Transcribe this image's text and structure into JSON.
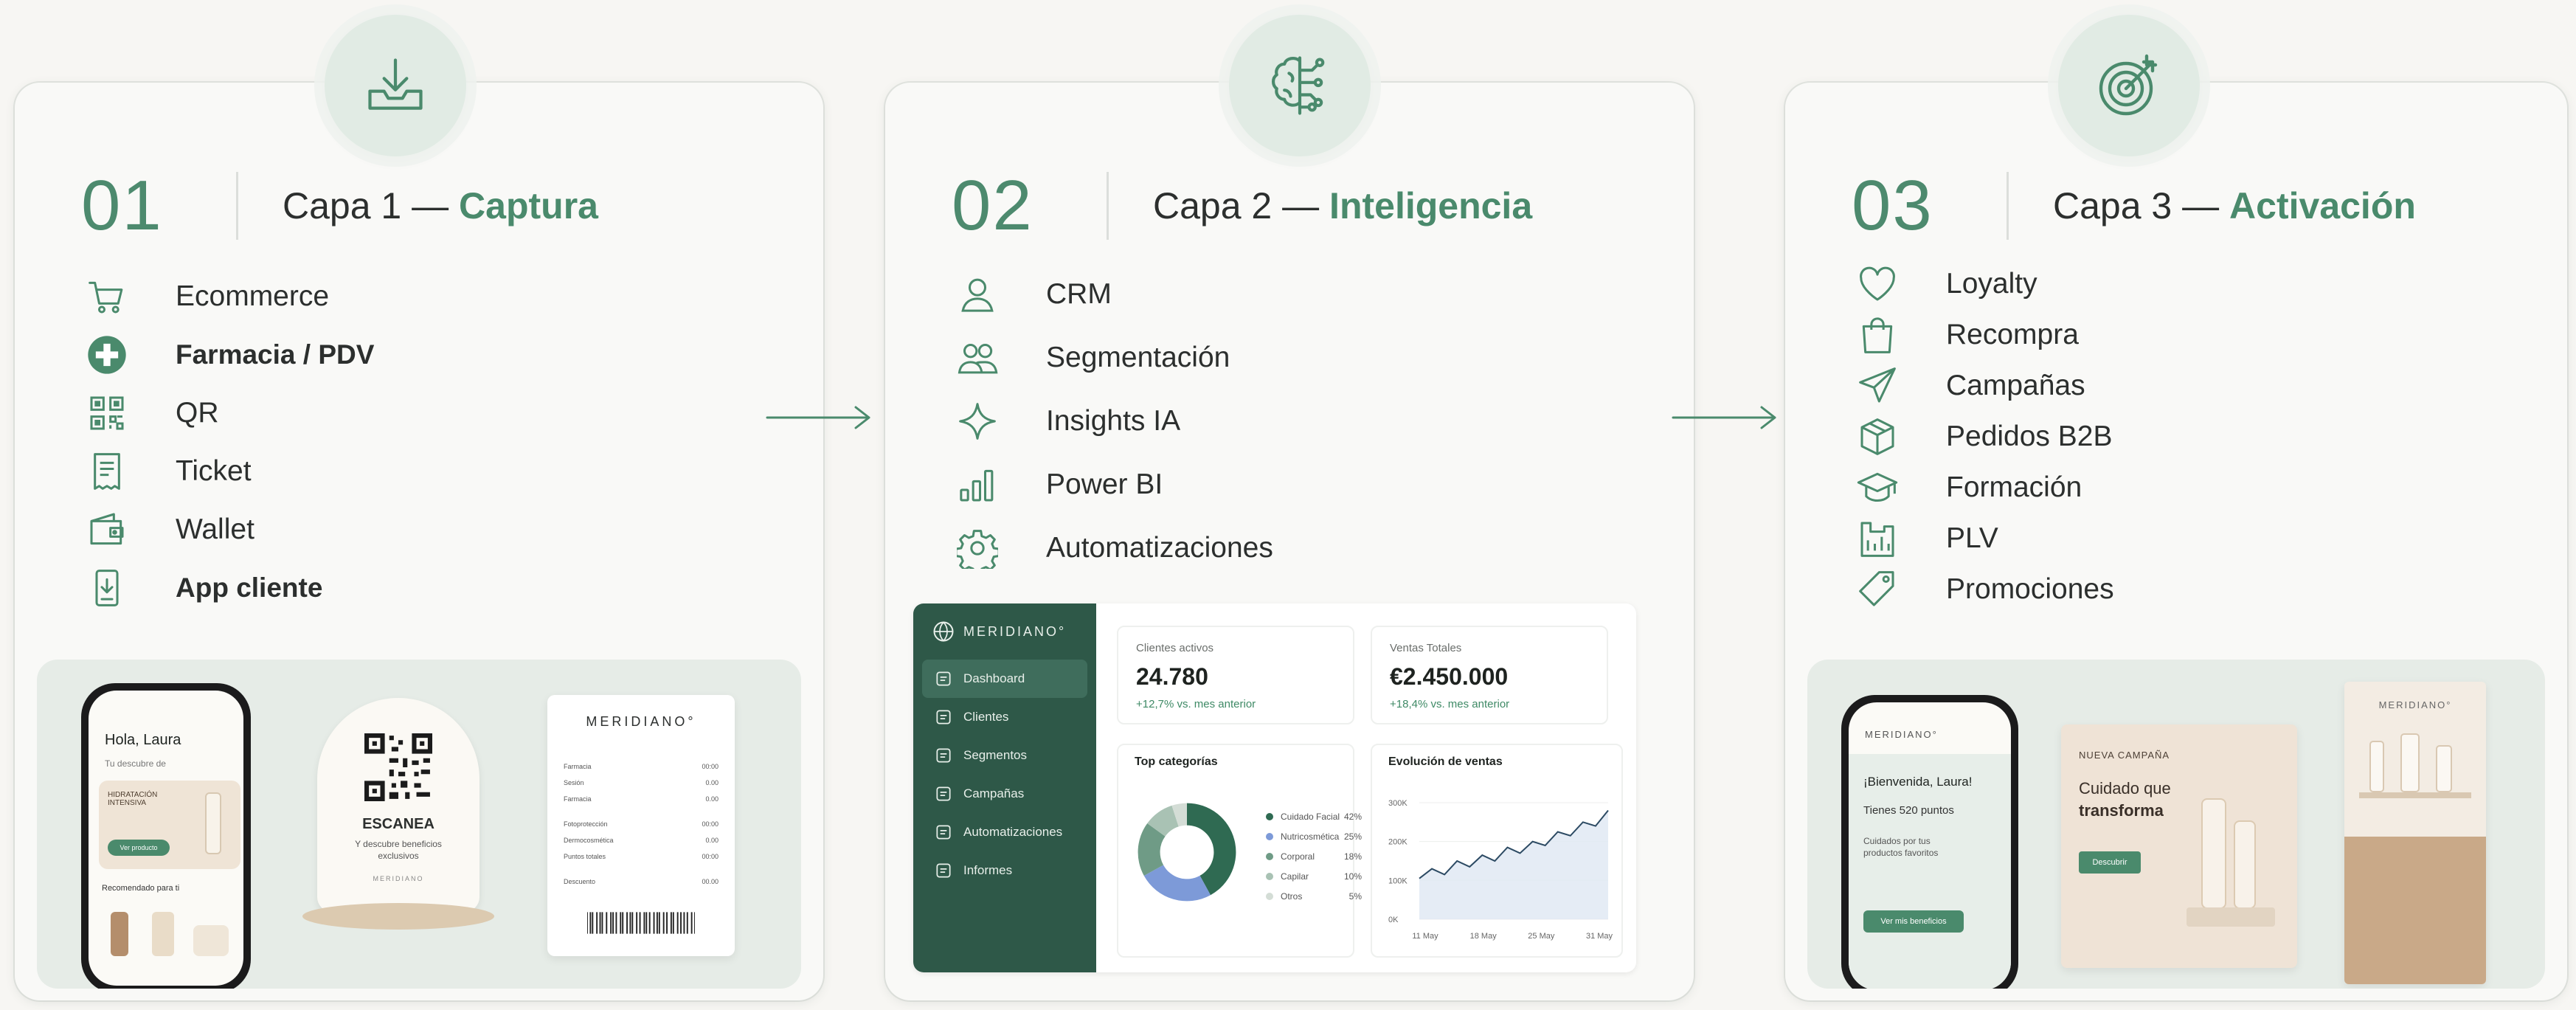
{
  "colors": {
    "accent": "#4a8a6c",
    "badge_bg": "#e1ebe4",
    "dashboard_sidebar": "#2e5848"
  },
  "layers": [
    {
      "number": "01",
      "label": "Capa 1",
      "dash": "—",
      "name": "Captura",
      "badge_icon": "download-tray-icon",
      "items": [
        {
          "label": "Ecommerce",
          "icon": "cart-icon"
        },
        {
          "label": "Farmacia / PDV",
          "icon": "pharmacy-cross-icon"
        },
        {
          "label": "QR",
          "icon": "qr-icon"
        },
        {
          "label": "Ticket",
          "icon": "receipt-icon"
        },
        {
          "label": "Wallet",
          "icon": "wallet-icon"
        },
        {
          "label": "App cliente",
          "icon": "app-download-icon"
        }
      ]
    },
    {
      "number": "02",
      "label": "Capa 2",
      "dash": "—",
      "name": "Inteligencia",
      "badge_icon": "brain-circuit-icon",
      "items": [
        {
          "label": "CRM",
          "icon": "user-icon"
        },
        {
          "label": "Segmentación",
          "icon": "users-icon"
        },
        {
          "label": "Insights IA",
          "icon": "sparkle-icon"
        },
        {
          "label": "Power BI",
          "icon": "bar-chart-icon"
        },
        {
          "label": "Automatizaciones",
          "icon": "gear-icon"
        }
      ]
    },
    {
      "number": "03",
      "label": "Capa 3",
      "dash": "—",
      "name": "Activación",
      "badge_icon": "target-icon",
      "items": [
        {
          "label": "Loyalty",
          "icon": "heart-icon"
        },
        {
          "label": "Recompra",
          "icon": "shopping-bag-icon"
        },
        {
          "label": "Campañas",
          "icon": "paper-plane-icon"
        },
        {
          "label": "Pedidos B2B",
          "icon": "box-icon"
        },
        {
          "label": "Formación",
          "icon": "graduation-cap-icon"
        },
        {
          "label": "PLV",
          "icon": "display-stand-icon"
        },
        {
          "label": "Promociones",
          "icon": "tag-icon"
        }
      ]
    }
  ],
  "capture_mockup": {
    "phone_greeting": "Hola, Laura",
    "phone_sub": "Tu descubre de",
    "promo_title": "HIDRATACIÓN INTENSIVA",
    "promo_button": "Ver producto",
    "recommended": "Recomendado para ti",
    "qr_heading": "ESCANEA",
    "qr_text": "Y descubre beneficios exclusivos",
    "qr_brand": "MERIDIANO",
    "ticket_brand": "MERIDIANO°",
    "ticket_lines": [
      {
        "name": "Farmacia",
        "value": "00:00"
      },
      {
        "name": "Sesión",
        "value": "0.00"
      },
      {
        "name": "Farmacia",
        "value": "0.00"
      },
      {
        "name": "Fotoprotección",
        "value": "00:00"
      },
      {
        "name": "Dermocosmética",
        "value": "0.00"
      },
      {
        "name": "Puntos totales",
        "value": "00:00"
      },
      {
        "name": "Descuento",
        "value": "00.00"
      }
    ]
  },
  "dashboard": {
    "brand": "MERIDIANO°",
    "nav": [
      {
        "label": "Dashboard",
        "icon": "grid-icon",
        "active": true
      },
      {
        "label": "Clientes",
        "icon": "id-card-icon"
      },
      {
        "label": "Segmentos",
        "icon": "segments-icon"
      },
      {
        "label": "Campañas",
        "icon": "megaphone-icon"
      },
      {
        "label": "Automatizaciones",
        "icon": "automation-icon"
      },
      {
        "label": "Informes",
        "icon": "report-icon"
      }
    ],
    "kpis": [
      {
        "label": "Clientes activos",
        "value": "24.780",
        "delta": "+12,7% vs. mes anterior"
      },
      {
        "label": "Ventas Totales",
        "value": "€2.450.000",
        "delta": "+18,4% vs. mes anterior"
      }
    ],
    "categories_title": "Top categorías",
    "sales_title": "Evolución de ventas"
  },
  "chart_data": [
    {
      "type": "pie",
      "title": "Top categorías",
      "categories": [
        "Cuidado Facial",
        "Nutricosmética",
        "Corporal",
        "Capilar",
        "Otros"
      ],
      "values": [
        42,
        25,
        18,
        10,
        5
      ],
      "value_labels": [
        "42%",
        "25%",
        "18%",
        "10%",
        "5%"
      ],
      "colors": [
        "#2f6a52",
        "#7d9ad8",
        "#6f9b86",
        "#a9c2b4",
        "#d4ddd6"
      ]
    },
    {
      "type": "area",
      "title": "Evolución de ventas",
      "x": [
        "11 May",
        "18 May",
        "25 May",
        "31 May"
      ],
      "y_ticks": [
        "300K",
        "200K",
        "100K",
        "0K"
      ],
      "ylim": [
        0,
        300
      ],
      "series": [
        {
          "values": [
            105,
            130,
            115,
            150,
            135,
            165,
            150,
            185,
            170,
            200,
            190,
            225,
            215,
            250,
            240,
            280
          ]
        }
      ]
    }
  ],
  "activation_mockup": {
    "phone_brand": "MERIDIANO°",
    "welcome": "¡Bienvenida, Laura!",
    "points": "Tienes 520 puntos",
    "care_text": "Cuidados por tus productos favoritos",
    "benefits_button": "Ver mis beneficios",
    "campaign_label": "NUEVA CAMPAÑA",
    "campaign_title_1": "Cuidado que",
    "campaign_title_2": "transforma",
    "campaign_button": "Descubrir",
    "stand_brand": "MERIDIANO°"
  }
}
